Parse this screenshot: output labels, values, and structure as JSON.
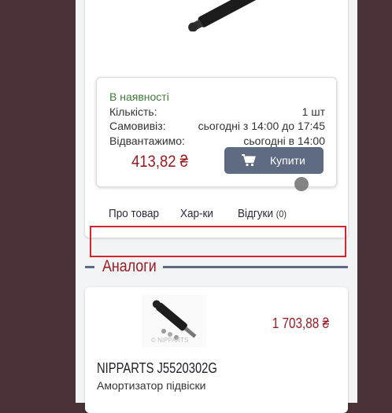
{
  "stock": {
    "availability": "В наявності",
    "rows": [
      {
        "label": "Кількість:",
        "value": "1 шт"
      },
      {
        "label": "Самовивіз:",
        "value": "сьогодні з 14:00 до 17:45"
      },
      {
        "label": "Відвантажимо:",
        "value": "сьогодні в 14:00"
      }
    ],
    "price": "413,82 ₴",
    "buy_label": "Купити"
  },
  "tabs": [
    {
      "label": "Про товар",
      "count": ""
    },
    {
      "label": "Хар-ки",
      "count": ""
    },
    {
      "label": "Відгуки",
      "count": "(0)"
    }
  ],
  "analogs": {
    "title": "Аналоги",
    "items": [
      {
        "name": "NIPPARTS J5520302G",
        "description": "Амортизатор підвіски",
        "price": "1 703,88 ₴",
        "image_watermark": "© NIPPARTS"
      }
    ]
  },
  "colors": {
    "price": "#9b1b22",
    "available": "#3e7d37",
    "button": "#5e6b82",
    "highlight": "#d4252f"
  }
}
